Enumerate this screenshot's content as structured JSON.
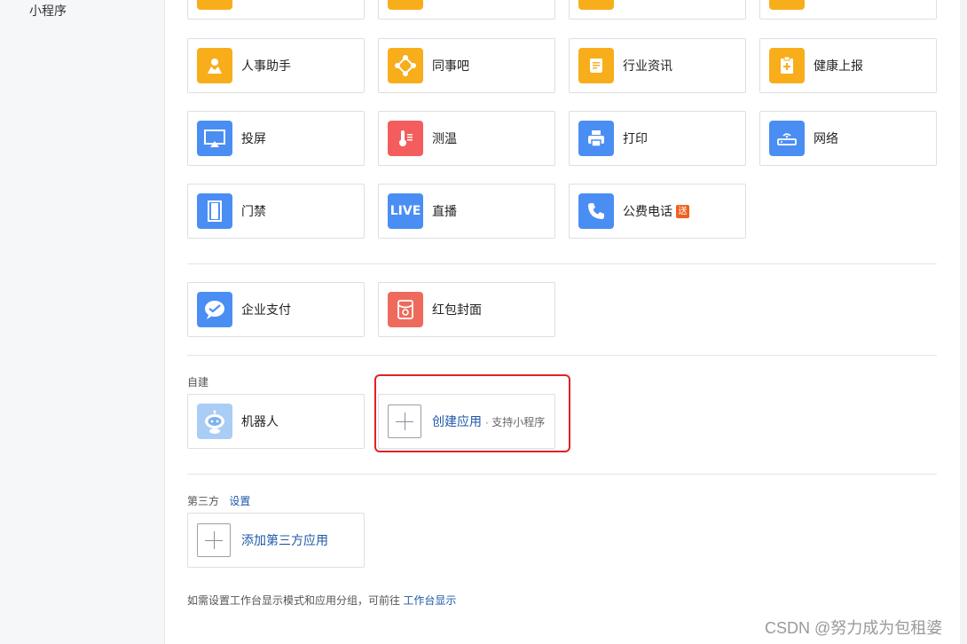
{
  "sidebar": {
    "item": "小程序"
  },
  "apps_row1": [
    {
      "label": "人事助手",
      "icon": "person-badge-icon",
      "color": "#f8ad1a"
    },
    {
      "label": "同事吧",
      "icon": "network-nodes-icon",
      "color": "#f8ad1a"
    },
    {
      "label": "行业资讯",
      "icon": "news-doc-icon",
      "color": "#f8ad1a"
    },
    {
      "label": "健康上报",
      "icon": "health-clipboard-icon",
      "color": "#f8ad1a"
    }
  ],
  "apps_row2": [
    {
      "label": "投屏",
      "icon": "screen-cast-icon",
      "color": "#4a8ef4"
    },
    {
      "label": "测温",
      "icon": "thermometer-icon",
      "color": "#f45d5d"
    },
    {
      "label": "打印",
      "icon": "printer-icon",
      "color": "#4a8ef4"
    },
    {
      "label": "网络",
      "icon": "router-icon",
      "color": "#4a8ef4"
    }
  ],
  "apps_row3": [
    {
      "label": "门禁",
      "icon": "door-icon",
      "color": "#4a8ef4"
    },
    {
      "label": "直播",
      "icon": "live-icon",
      "icon_text": "LIVE",
      "color": "#4a8ef4"
    },
    {
      "label": "公费电话",
      "icon": "phone-icon",
      "color": "#4a8ef4",
      "badge": "送"
    }
  ],
  "apps_pay": [
    {
      "label": "企业支付",
      "icon": "wechat-pay-icon",
      "color": "#4a8ef4"
    },
    {
      "label": "红包封面",
      "icon": "red-envelope-icon",
      "color": "#ee6a5c"
    }
  ],
  "custom": {
    "title": "自建",
    "robot_label": "机器人",
    "create_label": "创建应用",
    "create_sub": "· 支持小程序"
  },
  "third_party": {
    "title": "第三方",
    "settings_link": "设置",
    "add_label": "添加第三方应用"
  },
  "footer": {
    "note": "如需设置工作台显示模式和应用分组，可前往",
    "link": "工作台显示"
  },
  "watermark": "CSDN @努力成为包租婆"
}
